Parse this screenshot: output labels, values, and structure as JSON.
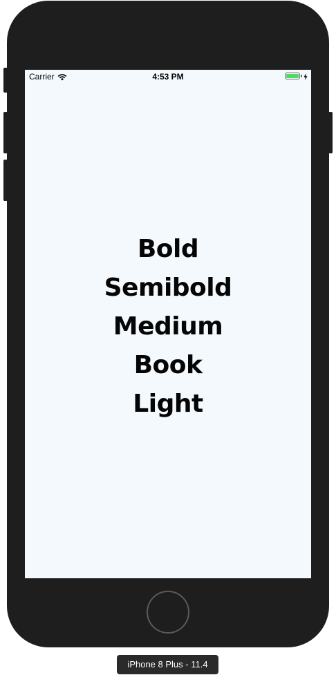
{
  "status_bar": {
    "carrier": "Carrier",
    "time": "4:53 PM",
    "battery_level": 1.0
  },
  "content": {
    "labels": [
      "Bold",
      "Semibold",
      "Medium",
      "Book",
      "Light"
    ]
  },
  "simulator": {
    "device_label": "iPhone 8 Plus - 11.4"
  },
  "icons": {
    "wifi": "wifi-icon",
    "battery": "battery-icon",
    "charging": "charging-bolt-icon"
  },
  "colors": {
    "screen_background": "#f3f9fd",
    "device_body": "#1e1e1e",
    "battery_green": "#4cd964",
    "text": "#050505"
  }
}
